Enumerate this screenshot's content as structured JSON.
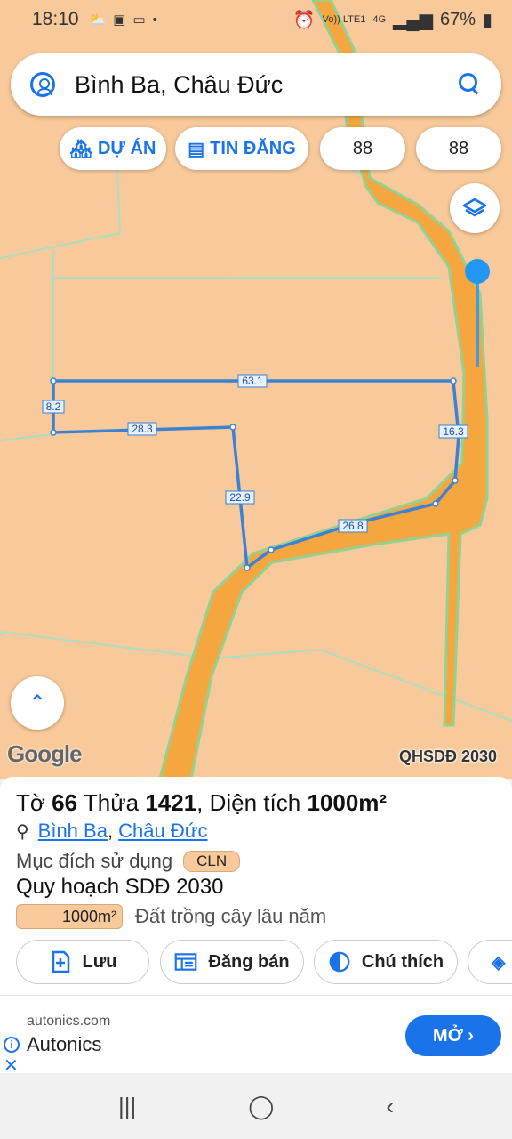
{
  "status_bar": {
    "time": "18:10",
    "icons_left": [
      "weather-icon",
      "gallery-icon",
      "zalo-icon",
      "dot-icon"
    ],
    "volte": "Vo)) LTE1",
    "network": "4G",
    "battery": "67%"
  },
  "search": {
    "text": "Bình Ba, Châu Đức"
  },
  "chips": {
    "projects": "DỰ ÁN",
    "listings": "TIN ĐĂNG",
    "value1": "88",
    "value2": "88"
  },
  "map": {
    "google_label": "Google",
    "layer_label": "QHSDĐ 2030",
    "edge_labels": [
      "63.1",
      "8.2",
      "28.3",
      "16.3",
      "22.9",
      "26.8"
    ],
    "colors": {
      "land": "#f8c99a",
      "road": "#f5a53b",
      "boundary": "#3b82d6"
    }
  },
  "info": {
    "title_prefix": "Tờ",
    "sheet": "66",
    "plot_prefix": "Thửa",
    "plot": "1421",
    "area_prefix": ", Diện tích",
    "area": "1000m²",
    "commune": "Bình Ba",
    "district": "Châu Đức",
    "purpose_label": "Mục đích sử dụng",
    "purpose_code": "CLN",
    "plan_label": "Quy hoạch SDĐ 2030",
    "plan_area": "1000m²",
    "plan_desc": "Đất trồng cây lâu năm"
  },
  "actions": {
    "save": "Lưu",
    "post": "Đăng bán",
    "legend": "Chú thích"
  },
  "ad": {
    "domain": "autonics.com",
    "name": "Autonics",
    "open": "MỞ ›"
  },
  "nav": {
    "recents": "|||",
    "home": "◯",
    "back": "‹"
  }
}
